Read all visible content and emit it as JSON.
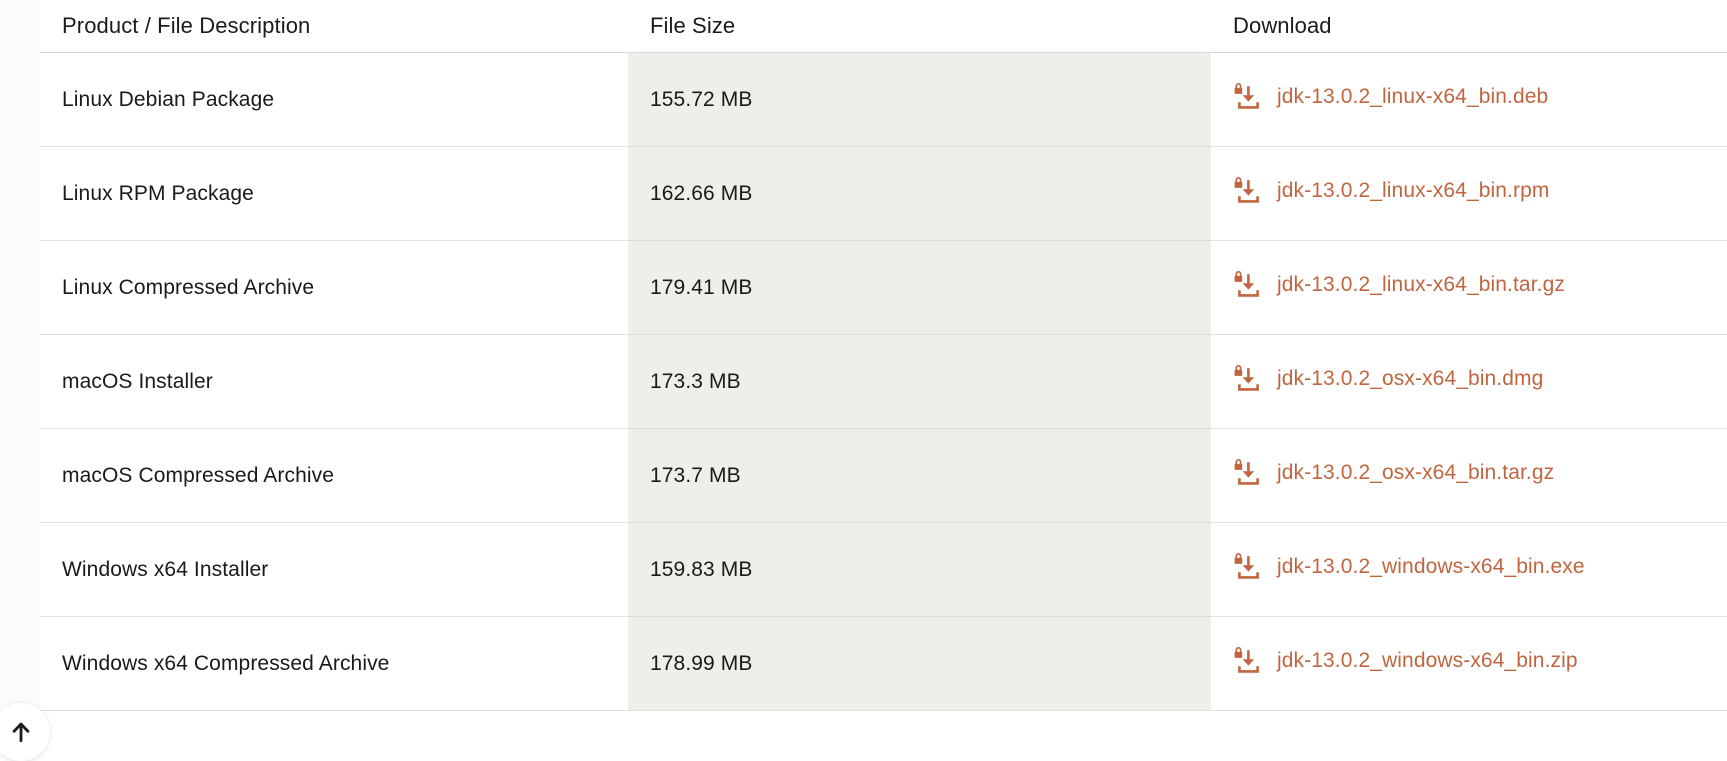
{
  "table": {
    "columns": [
      {
        "key": "description",
        "label": "Product / File Description"
      },
      {
        "key": "size",
        "label": "File Size"
      },
      {
        "key": "download",
        "label": "Download"
      }
    ],
    "rows": [
      {
        "description": "Linux Debian Package",
        "size": "155.72 MB",
        "download": "jdk-13.0.2_linux-x64_bin.deb",
        "icon": "download-lock-icon"
      },
      {
        "description": "Linux RPM Package",
        "size": "162.66 MB",
        "download": "jdk-13.0.2_linux-x64_bin.rpm",
        "icon": "download-lock-icon"
      },
      {
        "description": "Linux Compressed Archive",
        "size": "179.41 MB",
        "download": "jdk-13.0.2_linux-x64_bin.tar.gz",
        "icon": "download-lock-icon"
      },
      {
        "description": "macOS Installer",
        "size": "173.3 MB",
        "download": "jdk-13.0.2_osx-x64_bin.dmg",
        "icon": "download-lock-icon"
      },
      {
        "description": "macOS Compressed Archive",
        "size": "173.7 MB",
        "download": "jdk-13.0.2_osx-x64_bin.tar.gz",
        "icon": "download-lock-icon"
      },
      {
        "description": "Windows x64 Installer",
        "size": "159.83 MB",
        "download": "jdk-13.0.2_windows-x64_bin.exe",
        "icon": "download-lock-icon"
      },
      {
        "description": "Windows x64 Compressed Archive",
        "size": "178.99 MB",
        "download": "jdk-13.0.2_windows-x64_bin.zip",
        "icon": "download-lock-icon"
      }
    ]
  },
  "floating": {
    "back_to_top_icon": "arrow-up-icon"
  },
  "colors": {
    "link": "#c0653f",
    "icon": "#c0653f",
    "shaded_column": "#efeee9",
    "text": "#1a1a18",
    "row_divider": "#e3e1dd",
    "page_background": "#ffffff"
  }
}
